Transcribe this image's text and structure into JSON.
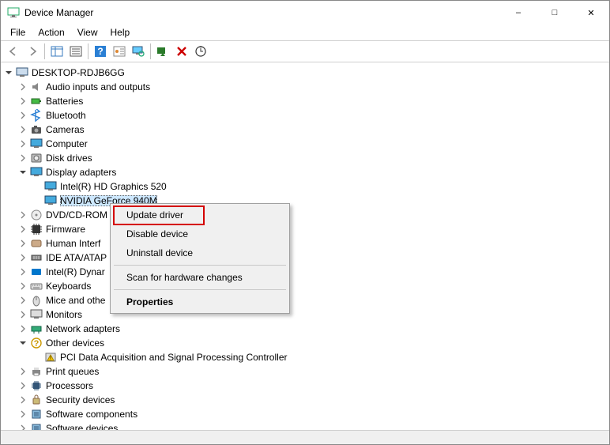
{
  "window": {
    "title": "Device Manager"
  },
  "menu": {
    "items": [
      "File",
      "Action",
      "View",
      "Help"
    ]
  },
  "toolbar": {
    "buttons": [
      {
        "name": "back-icon"
      },
      {
        "name": "forward-icon"
      },
      {
        "name": "show-hide-tree-icon"
      },
      {
        "name": "properties-pane-icon"
      },
      {
        "name": "help-icon"
      },
      {
        "name": "action-icon"
      },
      {
        "name": "scan-monitor-icon"
      },
      {
        "name": "scan-hardware-icon"
      },
      {
        "name": "delete-x-icon"
      },
      {
        "name": "update-refresh-icon"
      }
    ]
  },
  "tree": {
    "root": {
      "label": "DESKTOP-RDJB6GG",
      "expanded": true
    },
    "nodes": [
      {
        "label": "Audio inputs and outputs",
        "icon": "speaker",
        "exp": ">"
      },
      {
        "label": "Batteries",
        "icon": "battery",
        "exp": ">"
      },
      {
        "label": "Bluetooth",
        "icon": "bluetooth",
        "exp": ">"
      },
      {
        "label": "Cameras",
        "icon": "camera",
        "exp": ">"
      },
      {
        "label": "Computer",
        "icon": "monitor",
        "exp": ">"
      },
      {
        "label": "Disk drives",
        "icon": "disk",
        "exp": ">"
      },
      {
        "label": "Display adapters",
        "icon": "monitor",
        "exp": "v",
        "children": [
          {
            "label": "Intel(R) HD Graphics 520",
            "icon": "monitor"
          },
          {
            "label": "NVIDIA GeForce 940M",
            "icon": "monitor",
            "selected": true
          }
        ]
      },
      {
        "label": "DVD/CD-ROM",
        "icon": "cd",
        "exp": ">"
      },
      {
        "label": "Firmware",
        "icon": "chip",
        "exp": ">"
      },
      {
        "label": "Human Interf",
        "icon": "hid",
        "exp": ">"
      },
      {
        "label": "IDE ATA/ATAP",
        "icon": "ide",
        "exp": ">"
      },
      {
        "label": "Intel(R) Dynar",
        "icon": "intel",
        "exp": ">"
      },
      {
        "label": "Keyboards",
        "icon": "keyboard",
        "exp": ">"
      },
      {
        "label": "Mice and othe",
        "icon": "mouse",
        "exp": ">"
      },
      {
        "label": "Monitors",
        "icon": "monitor2",
        "exp": ">"
      },
      {
        "label": "Network adapters",
        "icon": "network",
        "exp": ">"
      },
      {
        "label": "Other devices",
        "icon": "other",
        "exp": "v",
        "children": [
          {
            "label": "PCI Data Acquisition and Signal Processing Controller",
            "icon": "warn"
          }
        ]
      },
      {
        "label": "Print queues",
        "icon": "printer",
        "exp": ">"
      },
      {
        "label": "Processors",
        "icon": "cpu",
        "exp": ">"
      },
      {
        "label": "Security devices",
        "icon": "security",
        "exp": ">"
      },
      {
        "label": "Software components",
        "icon": "soft",
        "exp": ">"
      },
      {
        "label": "Software devices",
        "icon": "soft",
        "exp": ">"
      }
    ]
  },
  "context_menu": {
    "items": [
      {
        "label": "Update driver",
        "bold": false,
        "highlighted": true
      },
      {
        "label": "Disable device"
      },
      {
        "label": "Uninstall device"
      },
      {
        "sep": true
      },
      {
        "label": "Scan for hardware changes"
      },
      {
        "sep": true
      },
      {
        "label": "Properties",
        "bold": true
      }
    ]
  }
}
